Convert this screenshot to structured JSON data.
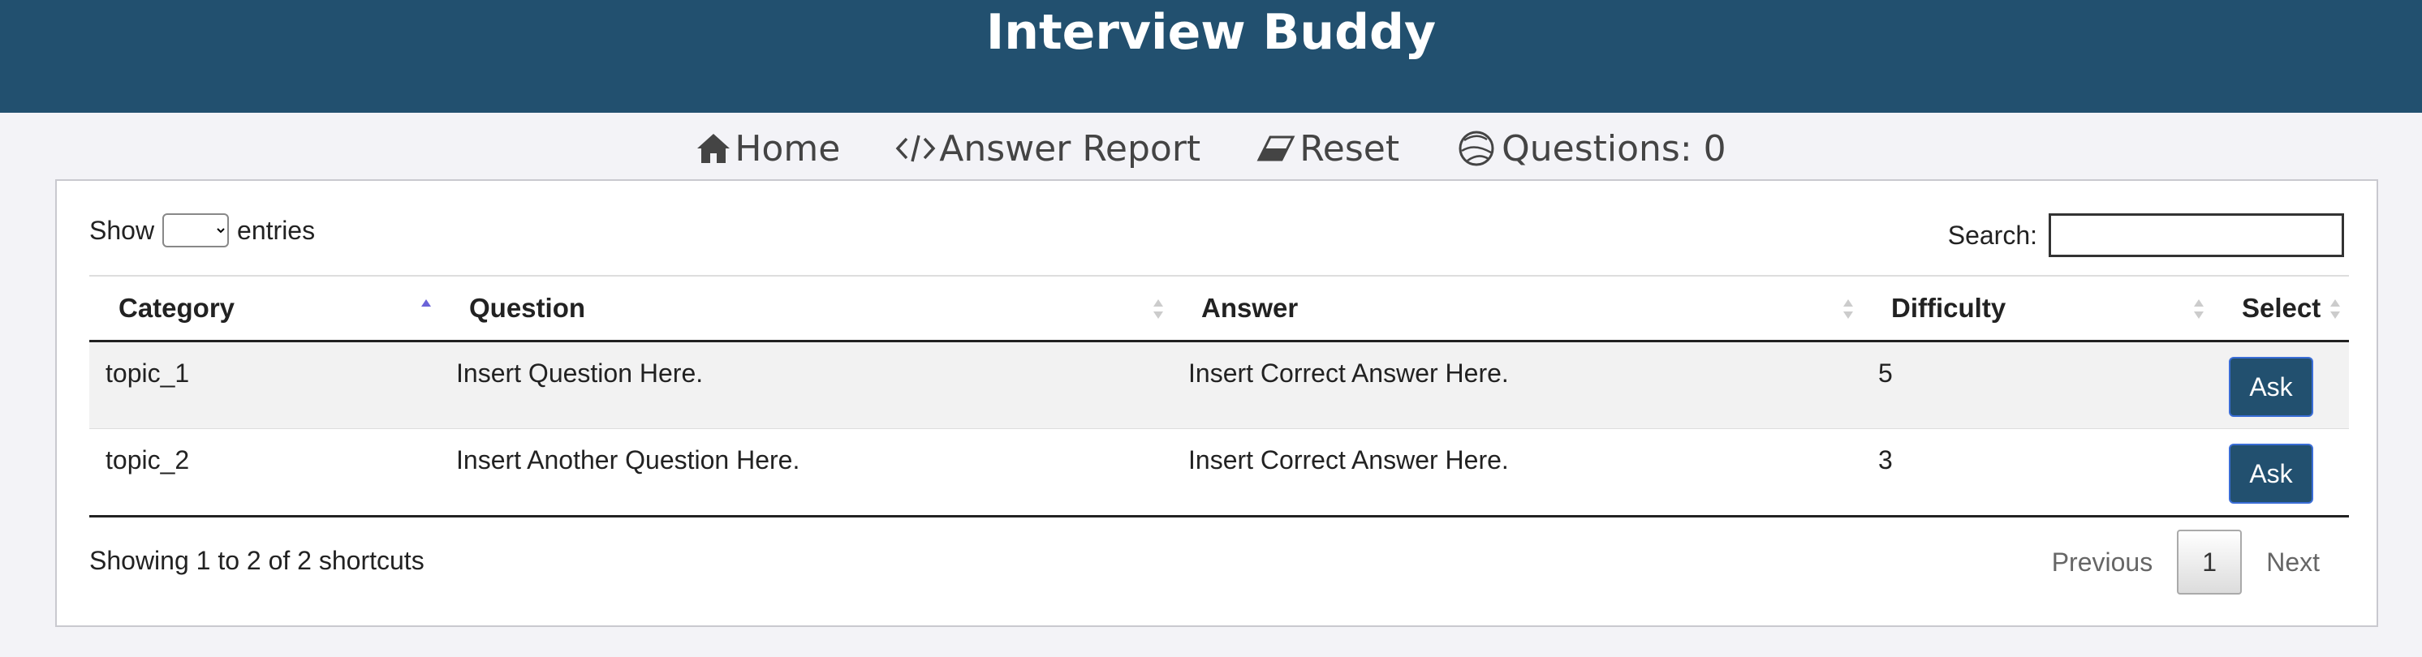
{
  "header": {
    "title": "Interview Buddy"
  },
  "nav": [
    {
      "label": "Home",
      "icon": "home-icon"
    },
    {
      "label": "Answer Report",
      "icon": "code-icon"
    },
    {
      "label": "Reset",
      "icon": "eraser-icon"
    },
    {
      "label": "Questions: 0",
      "icon": "globe-icon"
    }
  ],
  "table_controls": {
    "show_label": "Show",
    "entries_label": "entries",
    "search_label": "Search:",
    "search_value": ""
  },
  "columns": [
    "Category",
    "Question",
    "Answer",
    "Difficulty",
    "Select"
  ],
  "rows": [
    {
      "category": "topic_1",
      "question": "Insert Question Here.",
      "answer": "Insert Correct Answer Here.",
      "difficulty": "5",
      "action": "Ask"
    },
    {
      "category": "topic_2",
      "question": "Insert Another Question Here.",
      "answer": "Insert Correct Answer Here.",
      "difficulty": "3",
      "action": "Ask"
    }
  ],
  "footer": {
    "info": "Showing 1 to 2 of 2 shortcuts",
    "previous": "Previous",
    "page": "1",
    "next": "Next"
  },
  "colors": {
    "header_bg": "#22506f",
    "button_bg": "#22506f",
    "sort_active": "#6b63d8"
  }
}
